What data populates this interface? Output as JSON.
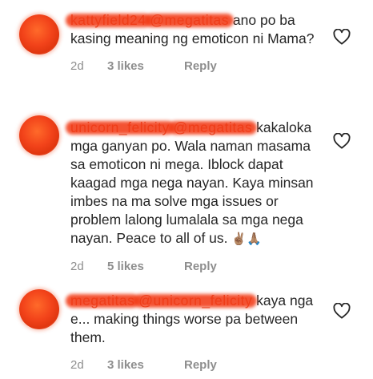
{
  "comments": [
    {
      "username": "kattyfield24",
      "mention": "@megatitas",
      "text": "ano po ba kasing meaning ng emoticon ni Mama?",
      "time": "2d",
      "likes": "3 likes",
      "reply": "Reply"
    },
    {
      "username": "unicorn_felicity",
      "mention": "@megatitas",
      "text": "kakaloka mga ganyan po. Wala naman masama sa emoticon ni mega. Iblock dapat kaagad mga nega nayan. Kaya minsan imbes na ma solve mga issues or problem lalong lumalala sa mga nega nayan. Peace to all of us.",
      "emojis": "✌🏽🙏🏽",
      "time": "2d",
      "likes": "5 likes",
      "reply": "Reply"
    },
    {
      "username": "megatitas",
      "mention": "@unicorn_felicity",
      "text": "kaya nga e... making things worse pa between them.",
      "time": "2d",
      "likes": "3 likes",
      "reply": "Reply"
    }
  ],
  "icons": {
    "like": "heart-outline-icon",
    "avatar": "avatar"
  },
  "colors": {
    "text": "#262626",
    "meta": "#8e8e8e",
    "redaction": "#f23b16"
  }
}
